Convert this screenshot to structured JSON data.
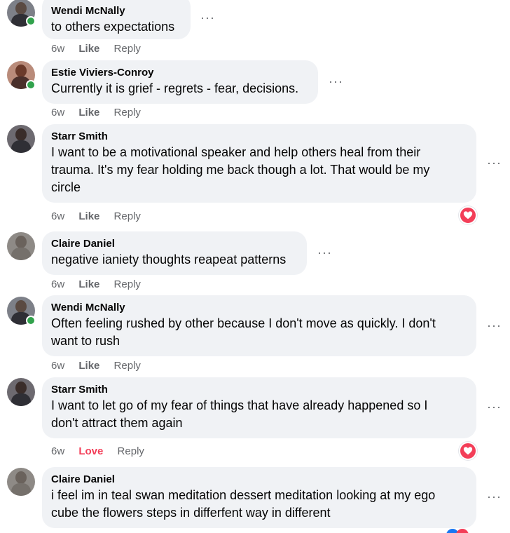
{
  "comments": [
    {
      "author": "Wendi McNally",
      "text": "to others expectations",
      "time": "6w",
      "reaction_label": "Like",
      "reply_label": "Reply",
      "online": true,
      "reaction": null
    },
    {
      "author": "Estie Viviers-Conroy",
      "text": "Currently it is grief - regrets - fear, decisions.",
      "time": "6w",
      "reaction_label": "Like",
      "reply_label": "Reply",
      "online": true,
      "reaction": null
    },
    {
      "author": "Starr Smith",
      "text_lines": [
        "I want to be a motivational speaker and help others heal from their",
        "trauma. It's my fear holding me back though a lot. That would be my",
        "circle"
      ],
      "time": "6w",
      "reaction_label": "Like",
      "reply_label": "Reply",
      "online": false,
      "reaction": "love"
    },
    {
      "author": "Claire Daniel",
      "text": "negative ianiety thoughts reapeat patterns",
      "time": "6w",
      "reaction_label": "Like",
      "reply_label": "Reply",
      "online": false,
      "reaction": null
    },
    {
      "author": "Wendi McNally",
      "text_lines": [
        "Often feeling rushed by other because I don't move as quickly. I don't",
        "want to rush"
      ],
      "time": "6w",
      "reaction_label": "Like",
      "reply_label": "Reply",
      "online": true,
      "reaction": null
    },
    {
      "author": "Starr Smith",
      "text_lines": [
        "I want to let go of my fear of things that have already happened so I",
        "don't attract them again"
      ],
      "time": "6w",
      "reaction_label": "Love",
      "reply_label": "Reply",
      "online": false,
      "reaction": "love"
    },
    {
      "author": "Claire Daniel",
      "text_lines": [
        "i feel im in teal swan meditation dessert meditation looking at my ego",
        "cube the flowers steps in differfent way in different"
      ],
      "time": "",
      "reaction_label": "",
      "reply_label": "",
      "online": false,
      "reaction": null
    }
  ],
  "colors": {
    "bubble": "#f0f2f5",
    "meta_text": "#65676b",
    "love": "#f33e58",
    "online": "#31a24c"
  },
  "icons": {
    "more": "more-options-icon",
    "love": "heart-icon"
  }
}
